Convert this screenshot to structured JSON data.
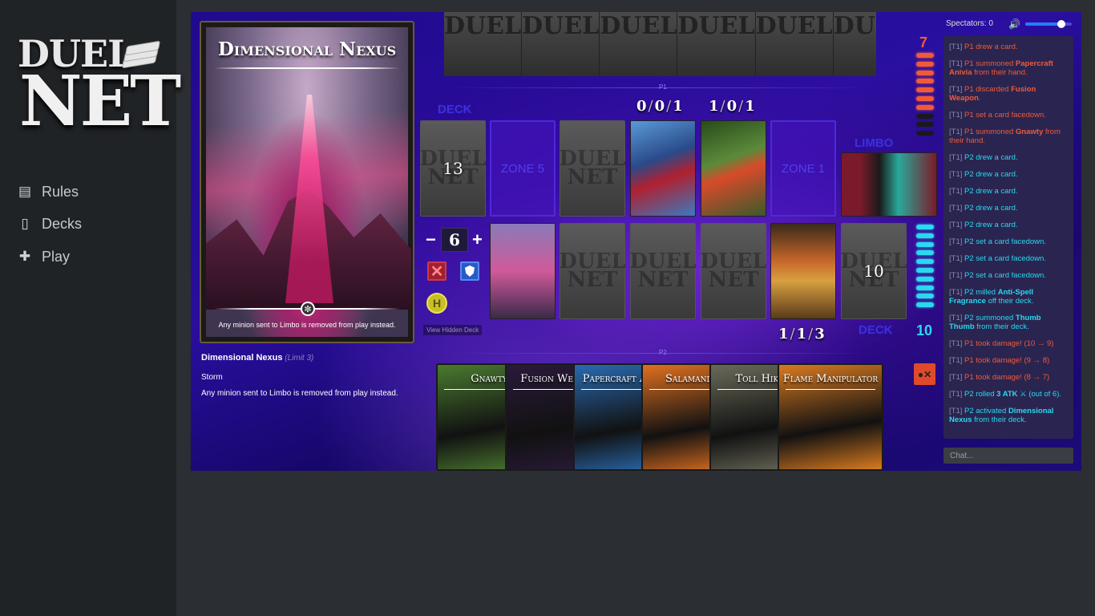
{
  "brand": {
    "line1": "DUEL",
    "line2": "NET"
  },
  "nav": [
    {
      "label": "Rules",
      "icon": "rules-icon"
    },
    {
      "label": "Decks",
      "icon": "decks-icon"
    },
    {
      "label": "Play",
      "icon": "gamepad-icon"
    }
  ],
  "preview": {
    "title": "Dimensional Nexus",
    "text": "Any minion sent to Limbo is removed from play instead."
  },
  "card_info": {
    "name": "Dimensional Nexus",
    "limit": "(Limit 3)",
    "type": "Storm",
    "text": "Any minion sent to Limbo is removed from play instead."
  },
  "board": {
    "p1_label": "P1",
    "p2_label": "P2",
    "deck_label_top": "DECK",
    "deck_label_bottom": "DECK",
    "limbo_label": "LIMBO",
    "p1_deck_count": "13",
    "p2_deck_count": "10",
    "zone5_label": "ZONE 5",
    "zone1_label": "ZONE 1",
    "stat_a": [
      "0",
      "0",
      "1"
    ],
    "stat_b": [
      "1",
      "0",
      "1"
    ],
    "stat_c": [
      "1",
      "1",
      "3"
    ],
    "counter_value": "6",
    "view_hidden_label": "View Hidden Deck",
    "h_label": "H"
  },
  "life": {
    "p1": {
      "value": "7",
      "max_pips": 10,
      "filled": 7,
      "color": "#f05a3a"
    },
    "p2": {
      "value": "10",
      "max_pips": 10,
      "filled": 10,
      "color": "#2ad8f0"
    }
  },
  "field_cards": {
    "zone_card_1": "Papercraft Anivia",
    "zone_card_2": "Gnawty",
    "limbo_card": "Anti-Spell Fragrance",
    "p2_storm": "Dimensional Nexus",
    "p2_minion": "Thumb Thumb"
  },
  "hand": [
    {
      "name": "Gnawty",
      "bg": "#4a7a30"
    },
    {
      "name": "Fusion Weapon",
      "bg": "#2a1a3a"
    },
    {
      "name": "Papercraft Anivia",
      "bg": "#2a6ab0"
    },
    {
      "name": "Salamander",
      "bg": "#e07020"
    },
    {
      "name": "Toll Hiker",
      "bg": "#6a6a5a"
    },
    {
      "name": "Flame Manipulator",
      "bg": "#d87a20"
    }
  ],
  "spectators": "Spectators: 0",
  "log": [
    {
      "p": "p1",
      "html": "[T1] P1 drew a card."
    },
    {
      "p": "p1",
      "parts": [
        "[T1] P1 summoned ",
        "Papercraft Anivia",
        " from their hand."
      ]
    },
    {
      "p": "p1",
      "parts": [
        "[T1] P1 discarded ",
        "Fusion Weapon",
        "."
      ]
    },
    {
      "p": "p1",
      "html": "[T1] P1 set a card facedown."
    },
    {
      "p": "p1",
      "parts": [
        "[T1] P1 summoned ",
        "Gnawty",
        " from their hand."
      ]
    },
    {
      "p": "p2",
      "html": "[T1] P2 drew a card."
    },
    {
      "p": "p2",
      "html": "[T1] P2 drew a card."
    },
    {
      "p": "p2",
      "html": "[T1] P2 drew a card."
    },
    {
      "p": "p2",
      "html": "[T1] P2 drew a card."
    },
    {
      "p": "p2",
      "html": "[T1] P2 drew a card."
    },
    {
      "p": "p2",
      "html": "[T1] P2 set a card facedown."
    },
    {
      "p": "p2",
      "html": "[T1] P2 set a card facedown."
    },
    {
      "p": "p2",
      "html": "[T1] P2 set a card facedown."
    },
    {
      "p": "p2",
      "parts": [
        "[T1] P2 milled ",
        "Anti-Spell Fragrance",
        " off their deck."
      ]
    },
    {
      "p": "p2",
      "parts": [
        "[T1] P2 summoned ",
        "Thumb Thumb",
        " from their deck."
      ]
    },
    {
      "p": "p1",
      "html": "[T1] P1 took damage! (10 → 9)"
    },
    {
      "p": "p1",
      "html": "[T1] P1 took damage! (9 → 8)"
    },
    {
      "p": "p1",
      "html": "[T1] P1 took damage! (8 → 7)"
    },
    {
      "p": "p2",
      "parts": [
        "[T1] P2 rolled ",
        "3 ATK",
        " ⚔ (out of 6)."
      ]
    },
    {
      "p": "p2",
      "parts": [
        "[T1] P2 activated ",
        "Dimensional Nexus",
        " from their deck."
      ]
    }
  ],
  "chat_placeholder": "Chat..."
}
